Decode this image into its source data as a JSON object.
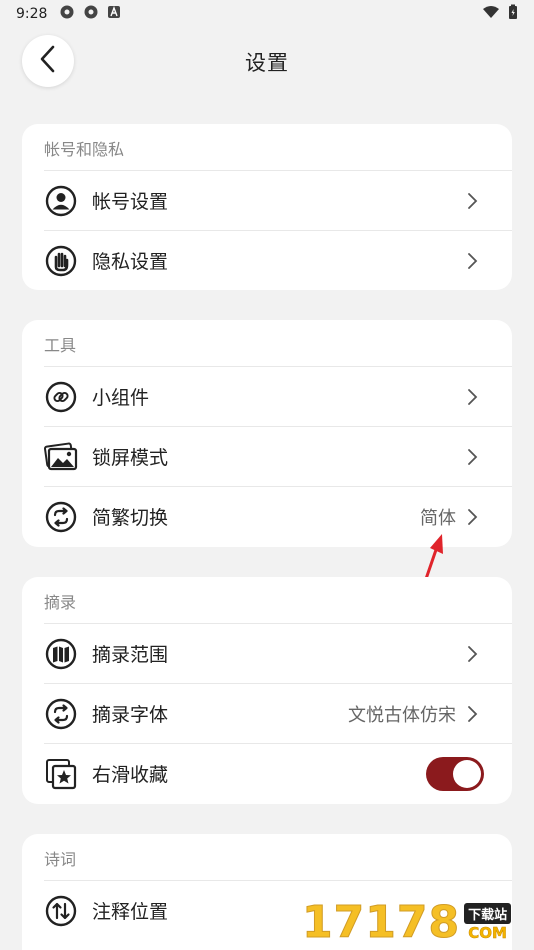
{
  "status_bar": {
    "time": "9:28",
    "icons": [
      "gear-icon",
      "gear-icon",
      "a-icon"
    ],
    "right_icons": [
      "wifi-icon",
      "battery-icon"
    ]
  },
  "header": {
    "title": "设置",
    "back_icon": "chevron-left-icon"
  },
  "sections": [
    {
      "title": "帐号和隐私",
      "items": [
        {
          "label": "帐号设置",
          "icon": "user-circle-icon",
          "value": ""
        },
        {
          "label": "隐私设置",
          "icon": "hand-stop-icon",
          "value": ""
        }
      ]
    },
    {
      "title": "工具",
      "items": [
        {
          "label": "小组件",
          "icon": "link-icon",
          "value": ""
        },
        {
          "label": "锁屏模式",
          "icon": "image-icon",
          "value": ""
        },
        {
          "label": "简繁切换",
          "icon": "swap-icon",
          "value": "简体"
        }
      ]
    },
    {
      "title": "摘录",
      "items": [
        {
          "label": "摘录范围",
          "icon": "map-icon",
          "value": ""
        },
        {
          "label": "摘录字体",
          "icon": "swap-icon",
          "value": "文悦古体仿宋"
        },
        {
          "label": "右滑收藏",
          "icon": "star-collection-icon",
          "toggle_on": true
        }
      ]
    },
    {
      "title": "诗词",
      "items": [
        {
          "label": "注释位置",
          "icon": "sort-arrows-icon",
          "value": ""
        }
      ]
    }
  ],
  "colors": {
    "accent": "#8b1a1d",
    "background": "#f2f2f2",
    "arrow": "#e0242b"
  },
  "watermark": {
    "number": "17178",
    "tag": "下载站",
    "domain": "COM"
  }
}
